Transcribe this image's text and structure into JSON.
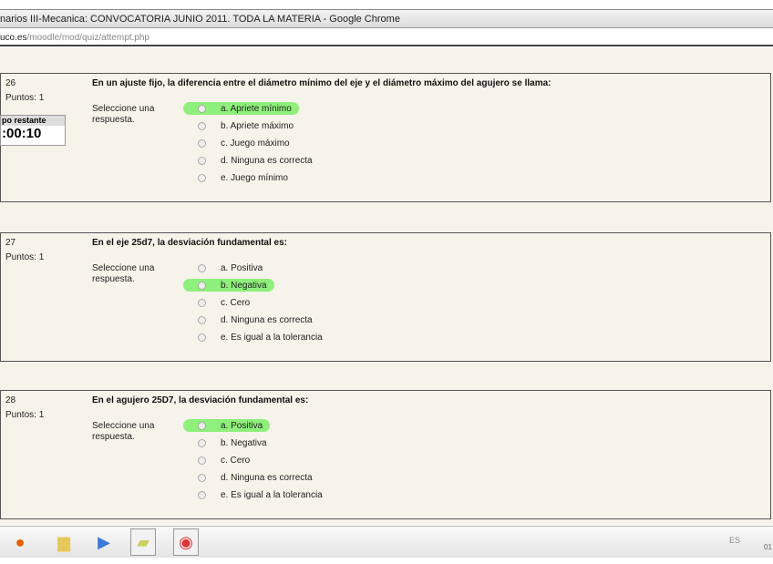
{
  "window": {
    "title": "narios III-Mecanica: CONVOCATORIA JUNIO 2011. TODA LA MATERIA - Google Chrome"
  },
  "address": {
    "domain": "uco.es",
    "path": "/moodle/mod/quiz/attempt.php"
  },
  "timer": {
    "label": "po restante",
    "value": ":00:10"
  },
  "questions": [
    {
      "number": "26",
      "points": "Puntos: 1",
      "text": "En un ajuste fijo, la diferencia entre el diámetro mínimo del eje y el diámetro máximo del agujero se llama:",
      "select_label": "Seleccione una respuesta.",
      "options": [
        "a. Apriete mínimo",
        "b. Apriete máximo",
        "c. Juego máximo",
        "d. Ninguna es correcta",
        "e. Juego mínimo"
      ],
      "highlighted": 0
    },
    {
      "number": "27",
      "points": "Puntos: 1",
      "text": "En el eje 25d7, la desviación fundamental es:",
      "select_label": "Seleccione una respuesta.",
      "options": [
        "a. Positiva",
        "b. Negativa",
        "c. Cero",
        "d. Ninguna es correcta",
        "e. Es igual a la tolerancia"
      ],
      "highlighted": 1
    },
    {
      "number": "28",
      "points": "Puntos: 1",
      "text": "En el agujero 25D7, la desviación fundamental es:",
      "select_label": "Seleccione una respuesta.",
      "options": [
        "a. Positiva",
        "b. Negativa",
        "c. Cero",
        "d. Ninguna es correcta",
        "e. Es igual a la tolerancia"
      ],
      "highlighted": 0
    }
  ],
  "taskbar": {
    "apps": [
      "firefox-icon",
      "folder-icon",
      "media-player-icon",
      "files-icon",
      "chrome-icon"
    ],
    "lang": "ES",
    "clock": "01"
  },
  "colors": {
    "highlight": "#8ef07a",
    "page_bg": "#f5f3ea"
  }
}
